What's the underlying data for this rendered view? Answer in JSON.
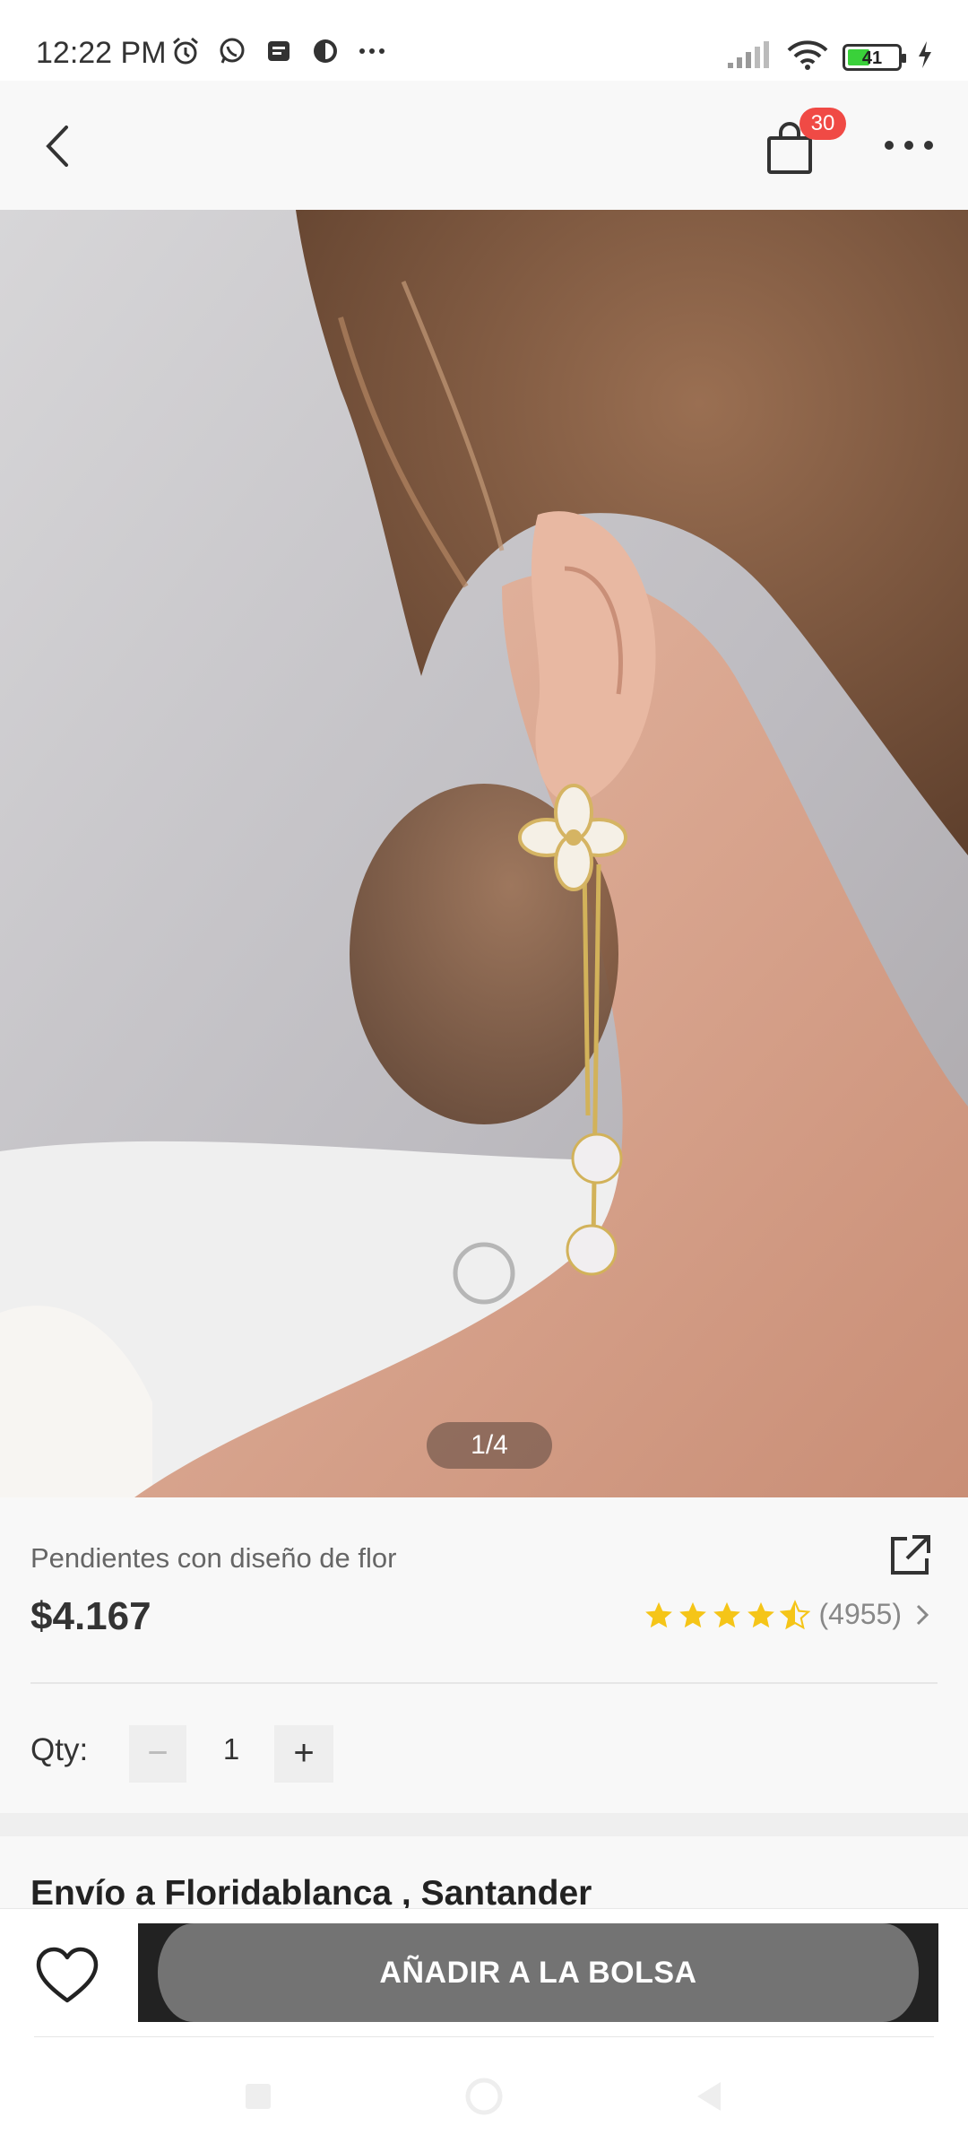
{
  "status_bar": {
    "time": "12:22 PM",
    "left_icons": [
      "alarm-icon",
      "whatsapp-icon",
      "message-icon",
      "app-icon",
      "more-dots-icon"
    ],
    "battery_level": "41",
    "right_icons": [
      "signal-icon",
      "wifi-icon",
      "battery-icon",
      "charging-icon"
    ]
  },
  "nav": {
    "back_icon": "chevron-left-icon",
    "bag_icon": "shopping-bag-icon",
    "bag_count": "30",
    "more_icon": "more-horizontal-icon"
  },
  "gallery": {
    "counter": "1/4",
    "current": 1,
    "total": 4
  },
  "product": {
    "name": "Pendientes con diseño de flor",
    "price": "$4.167",
    "rating_value": 4.5,
    "rating_count": "(4955)",
    "share_icon": "share-external-icon"
  },
  "quantity": {
    "label": "Qty:",
    "value": "1",
    "minus_label": "−",
    "plus_label": "+"
  },
  "shipping": {
    "title": "Envío a Floridablanca , Santander"
  },
  "actions": {
    "add_to_bag": "AÑADIR A LA BOLSA",
    "wishlist_icon": "heart-icon"
  },
  "colors": {
    "badge": "#f04a45",
    "star": "#f5c518",
    "button_dark": "#222222",
    "button_inner": "#737373"
  }
}
